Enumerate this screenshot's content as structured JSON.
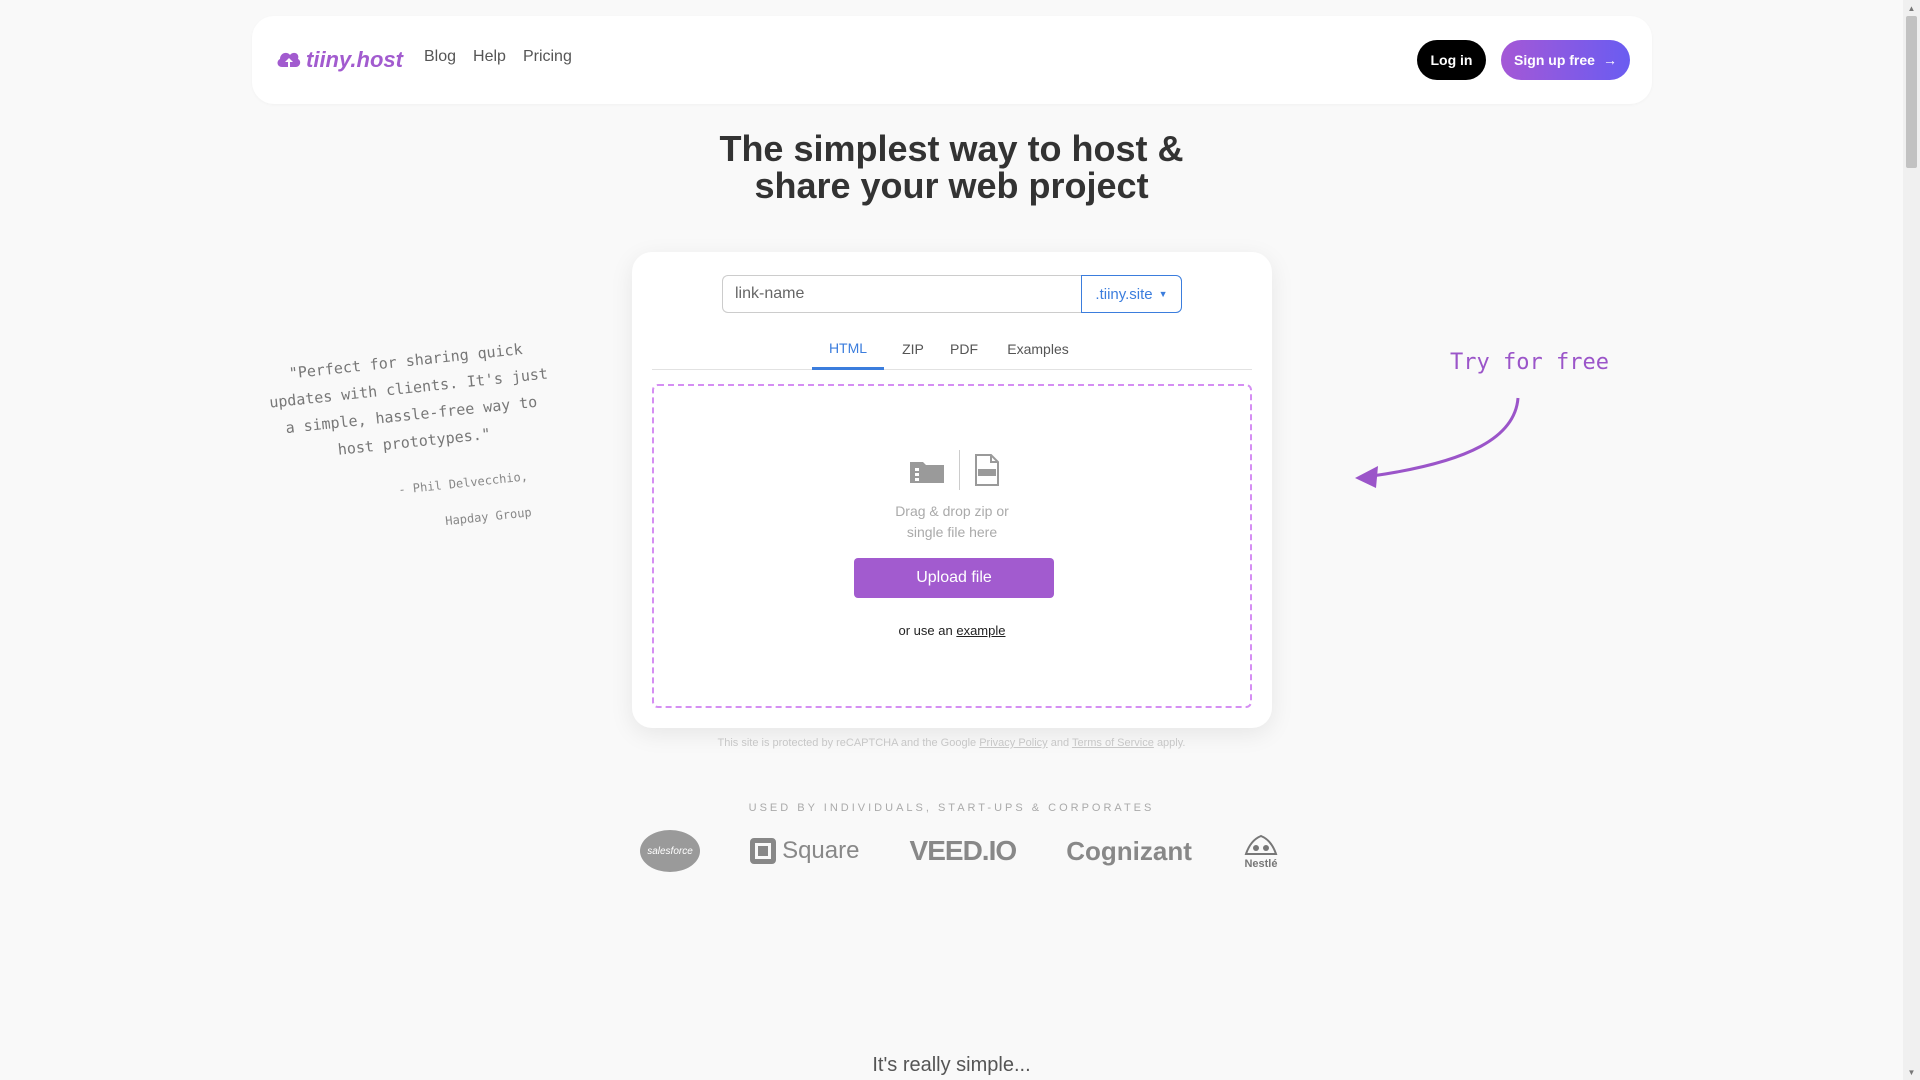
{
  "header": {
    "logo_text": "tiiny.host",
    "nav": [
      {
        "label": "Blog"
      },
      {
        "label": "Help"
      },
      {
        "label": "Pricing"
      }
    ],
    "login_label": "Log in",
    "signup_label": "Sign up free",
    "signup_arrow": "→",
    "brand_color": "#a25bcf"
  },
  "hero": {
    "title_line1": "The simplest way to host &",
    "title_line2": "share your web project"
  },
  "uploader": {
    "link_placeholder": "link-name",
    "domain": ".tiiny.site",
    "tabs": [
      {
        "label": "HTML",
        "active": true
      },
      {
        "label": "ZIP",
        "active": false
      },
      {
        "label": "PDF",
        "active": false
      },
      {
        "label": "Examples",
        "active": false
      }
    ],
    "drop_line1": "Drag & drop zip or",
    "drop_line2": "single file here",
    "upload_label": "Upload file",
    "or_text": "or use an",
    "example_link": "example"
  },
  "recaptcha": {
    "prefix": "This site is protected by reCAPTCHA and the Google",
    "privacy": "Privacy Policy",
    "and": "and",
    "terms": "Terms of Service",
    "suffix": "apply."
  },
  "used_by": {
    "heading": "USED BY INDIVIDUALS, START-UPS & CORPORATES",
    "brands": [
      "salesforce",
      "Square",
      "VEED.IO",
      "Cognizant",
      "Nestlé"
    ]
  },
  "testimonial": {
    "quote": "\"Perfect for sharing quick updates with clients. It's just a simple, hassle-free way to host prototypes.\"",
    "author_line1": "- Phil Delvecchio,",
    "author_line2": "Hapday Group"
  },
  "callout": {
    "try_free": "Try for free"
  },
  "footer_teaser": "It's really simple..."
}
